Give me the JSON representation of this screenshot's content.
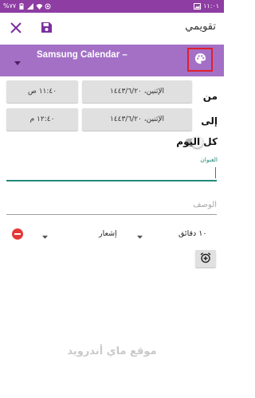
{
  "status_bar": {
    "battery": "%٧٧",
    "time": "١١:٠١",
    "icons": [
      "battery-icon",
      "signal-icon",
      "wifi-icon",
      "notification-icon",
      "gallery-icon"
    ]
  },
  "app_bar": {
    "title": "تقويمي",
    "close_icon": "close-icon",
    "save_icon": "save-icon"
  },
  "calendar_bar": {
    "calendar_name": "Samsung Calendar –",
    "dropdown_icon": "caret-down-icon",
    "palette_icon": "palette-icon",
    "background": "#a370c6",
    "highlight_color": "#e0202a"
  },
  "from": {
    "label": "من",
    "date": "الإثنين، ١٤٤٣/٦/٢٠",
    "time": "١١:٤٠ ص"
  },
  "to": {
    "label": "إلى",
    "date": "الإثنين، ١٤٤٣/٦/٢٠",
    "time": "١٢:٤٠ م"
  },
  "all_day": {
    "label": "كل اليوم",
    "enabled": false
  },
  "title_field": {
    "caption": "العنوان",
    "value": ""
  },
  "description_field": {
    "placeholder": "الوصف"
  },
  "reminder": {
    "type": "إشعار",
    "time": "١٠ دقائق",
    "remove_icon": "remove-icon",
    "add_icon": "add-alarm-icon"
  },
  "watermark": "موقع ماي أندرويد",
  "colors": {
    "status_bar": "#8e3da3",
    "accent": "#1f8a7a",
    "button_gray": "#e0e0e0"
  }
}
